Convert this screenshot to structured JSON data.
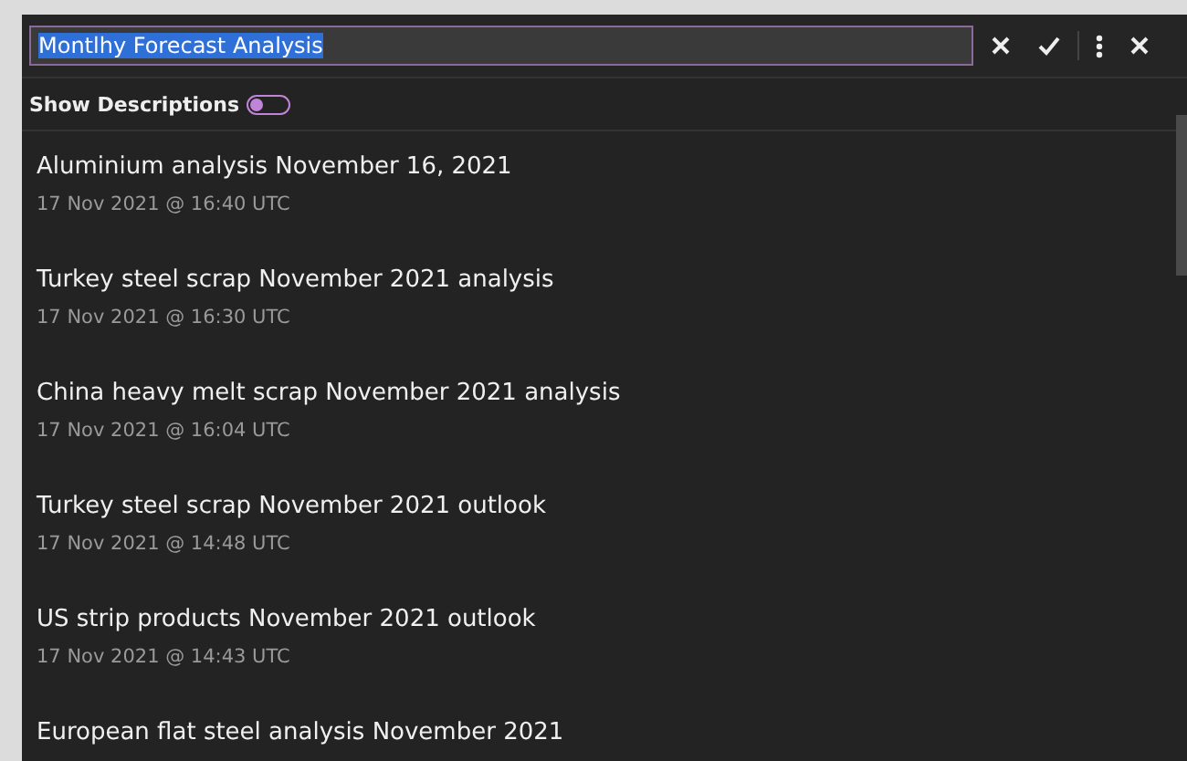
{
  "title_field": {
    "value": "Montlhy Forecast Analysis",
    "text_selected": true
  },
  "header_buttons": [
    {
      "kind": "cancel"
    },
    {
      "kind": "confirm"
    },
    {
      "kind": "more"
    },
    {
      "kind": "close"
    }
  ],
  "show_descriptions": {
    "label": "Show Descriptions",
    "on": false
  },
  "items": [
    {
      "title": "Aluminium analysis November 16, 2021",
      "date": "17 Nov 2021 @ 16:40 UTC"
    },
    {
      "title": "Turkey steel scrap November 2021 analysis",
      "date": "17 Nov 2021 @ 16:30 UTC"
    },
    {
      "title": "China heavy melt scrap November 2021 analysis",
      "date": "17 Nov 2021 @ 16:04 UTC"
    },
    {
      "title": "Turkey steel scrap November 2021 outlook",
      "date": "17 Nov 2021 @ 14:48 UTC"
    },
    {
      "title": "US strip products November 2021 outlook",
      "date": "17 Nov 2021 @ 14:43 UTC"
    },
    {
      "title": "European flat steel analysis November 2021"
    }
  ]
}
